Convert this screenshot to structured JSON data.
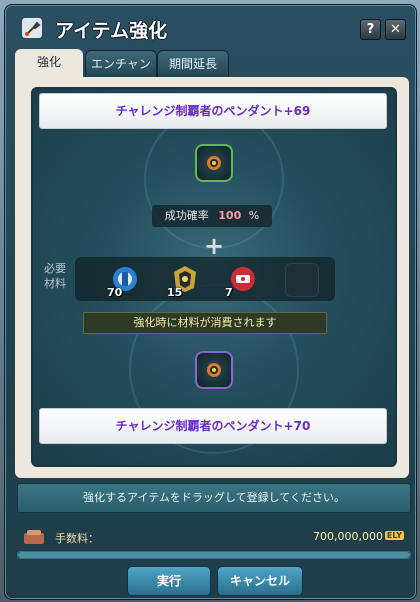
{
  "window": {
    "title": "アイテム強化",
    "help_label": "?",
    "close_label": "✕"
  },
  "tabs": [
    {
      "label": "強化",
      "active": true
    },
    {
      "label": "エンチャント",
      "active": false
    },
    {
      "label": "期間延長",
      "active": false
    }
  ],
  "item": {
    "current_name": "チャレンジ制覇者のペンダント+69",
    "next_name": "チャレンジ制覇者のペンダント+70",
    "icon": "pendant-icon"
  },
  "success": {
    "label": "成功確率",
    "value": "100",
    "unit": "%"
  },
  "materials": {
    "label": "必要\n材料",
    "items": [
      {
        "icon": "blue-orb-icon",
        "count": "70"
      },
      {
        "icon": "gold-emblem-icon",
        "count": "15"
      },
      {
        "icon": "red-gem-icon",
        "count": "7"
      }
    ]
  },
  "warning": "強化時に材料が消費されます",
  "hint": "強化するアイテムをドラッグして登録してください。",
  "fee": {
    "label": "手数料：",
    "value": "700,000,000",
    "unit": "ELY"
  },
  "progress": {
    "fraction": 1.0
  },
  "buttons": {
    "execute": "実行",
    "cancel": "キャンセル"
  },
  "colors": {
    "accent": "#6b2cc4",
    "warning_text": "#f5e9a7",
    "rate_value": "#ff9aa9"
  }
}
